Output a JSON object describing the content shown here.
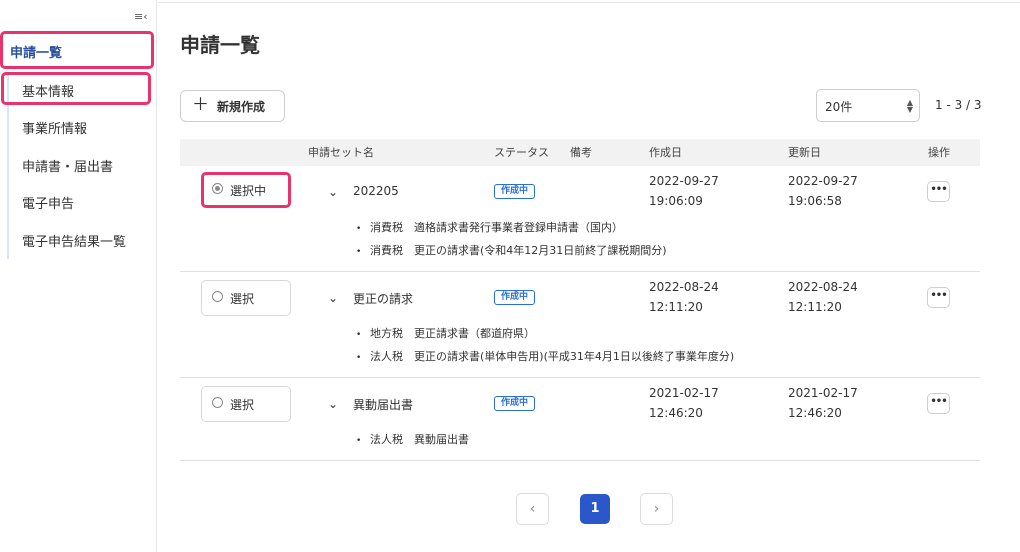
{
  "sidebar": {
    "collapse_icon": "collapse-menu-icon",
    "top_item": "申請一覧",
    "items": [
      {
        "label": "基本情報"
      },
      {
        "label": "事業所情報"
      },
      {
        "label": "申請書・届出書"
      },
      {
        "label": "電子申告"
      },
      {
        "label": "電子申告結果一覧"
      }
    ]
  },
  "main": {
    "title": "申請一覧",
    "new_button": "新規作成",
    "per_page": "20件",
    "range": "1 - 3 / 3",
    "columns": {
      "name": "申請セット名",
      "status": "ステータス",
      "note": "備考",
      "created": "作成日",
      "updated": "更新日",
      "actions": "操作"
    },
    "rows": [
      {
        "select_label": "選択中",
        "selected": true,
        "name": "202205",
        "status": "作成中",
        "created_date": "2022-09-27",
        "created_time": "19:06:09",
        "updated_date": "2022-09-27",
        "updated_time": "19:06:58",
        "items": [
          "消費税　適格請求書発行事業者登録申請書（国内）",
          "消費税　更正の請求書(令和4年12月31日前終了課税期間分)"
        ]
      },
      {
        "select_label": "選択",
        "selected": false,
        "name": "更正の請求",
        "status": "作成中",
        "created_date": "2022-08-24",
        "created_time": "12:11:20",
        "updated_date": "2022-08-24",
        "updated_time": "12:11:20",
        "items": [
          "地方税　更正請求書（都道府県）",
          "法人税　更正の請求書(単体申告用)(平成31年4月1日以後終了事業年度分)"
        ]
      },
      {
        "select_label": "選択",
        "selected": false,
        "name": "異動届出書",
        "status": "作成中",
        "created_date": "2021-02-17",
        "created_time": "12:46:20",
        "updated_date": "2021-02-17",
        "updated_time": "12:46:20",
        "items": [
          "法人税　異動届出書"
        ]
      }
    ],
    "pagination": {
      "prev": "‹",
      "current": "1",
      "next": "›"
    }
  },
  "colors": {
    "accent": "#2a57c9",
    "highlight": "#e8336d",
    "badge": "#2a6fd6"
  }
}
